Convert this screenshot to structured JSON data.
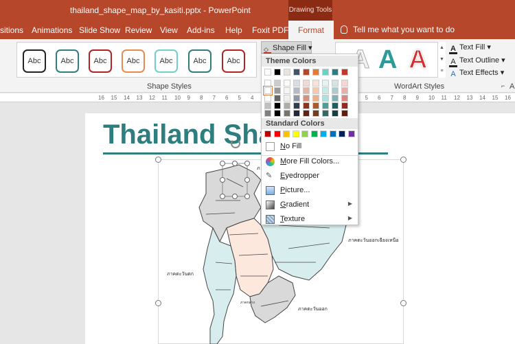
{
  "window": {
    "title": "thailand_shape_map_by_kasiti.pptx  -  PowerPoint",
    "context_tab_group": "Drawing Tools"
  },
  "ribbon_tabs": [
    {
      "label": "sitions"
    },
    {
      "label": "Animations"
    },
    {
      "label": "Slide Show"
    },
    {
      "label": "Review"
    },
    {
      "label": "View"
    },
    {
      "label": "Add-ins"
    },
    {
      "label": "Help"
    },
    {
      "label": "Foxit PDF"
    },
    {
      "label": "Format"
    }
  ],
  "tell_me": "Tell me what you want to do",
  "shape_styles": {
    "group_label": "Shape Styles",
    "swatch_label": "Abc",
    "swatch_colors": [
      "#222222",
      "#2e7d7f",
      "#b22222",
      "#e98a4f",
      "#6fcfc9",
      "#2e7d7f",
      "#b22222"
    ]
  },
  "wordart": {
    "group_label": "WordArt Styles",
    "letter": "A",
    "commands": [
      "Text Fill",
      "Text Outline",
      "Text Effects"
    ]
  },
  "next_group_label": "A",
  "shape_fill": {
    "button_label": "Shape Fill",
    "theme_colors_header": "Theme Colors",
    "standard_colors_header": "Standard Colors",
    "theme_top_row": [
      "#ffffff",
      "#000000",
      "#e8e6dc",
      "#44546a",
      "#b7472a",
      "#e07b39",
      "#6fcfc9",
      "#2e7d7f",
      "#c0392b"
    ],
    "standard_colors": [
      "#c00000",
      "#ff0000",
      "#ffc000",
      "#ffff00",
      "#92d050",
      "#00b050",
      "#00b0f0",
      "#0070c0",
      "#002060",
      "#7030a0"
    ],
    "items": [
      {
        "label_u": "N",
        "label_rest": "o Fill",
        "icon": "no-fill-icon"
      },
      {
        "label_u": "M",
        "label_rest": "ore Fill Colors...",
        "icon": "color-wheel-icon"
      },
      {
        "label_u": "E",
        "label_rest": "yedropper",
        "icon": "eyedropper-icon"
      },
      {
        "label_u": "P",
        "label_rest": "icture...",
        "icon": "picture-icon"
      },
      {
        "label_u": "G",
        "label_rest": "radient",
        "icon": "gradient-icon",
        "submenu": true
      },
      {
        "label_u": "T",
        "label_rest": "exture",
        "icon": "texture-icon",
        "submenu": true
      }
    ]
  },
  "ruler_ticks": [
    "16",
    "15",
    "14",
    "13",
    "12",
    "11",
    "10",
    "9",
    "8",
    "7",
    "6",
    "5",
    "4",
    "3",
    "2",
    "1",
    "0",
    "1",
    "2",
    "3",
    "4",
    "5",
    "6",
    "7",
    "8",
    "9",
    "10",
    "11",
    "12",
    "13",
    "14",
    "15",
    "16"
  ],
  "slide": {
    "title": "Thailand Sha",
    "labels": {
      "north": "ภ",
      "northeast": "ภาคตะวันออกเฉียงเหนือ",
      "west": "ภาคตะวันตก",
      "central": "ภาคกลาง",
      "east": "ภาคตะวันออก"
    }
  }
}
